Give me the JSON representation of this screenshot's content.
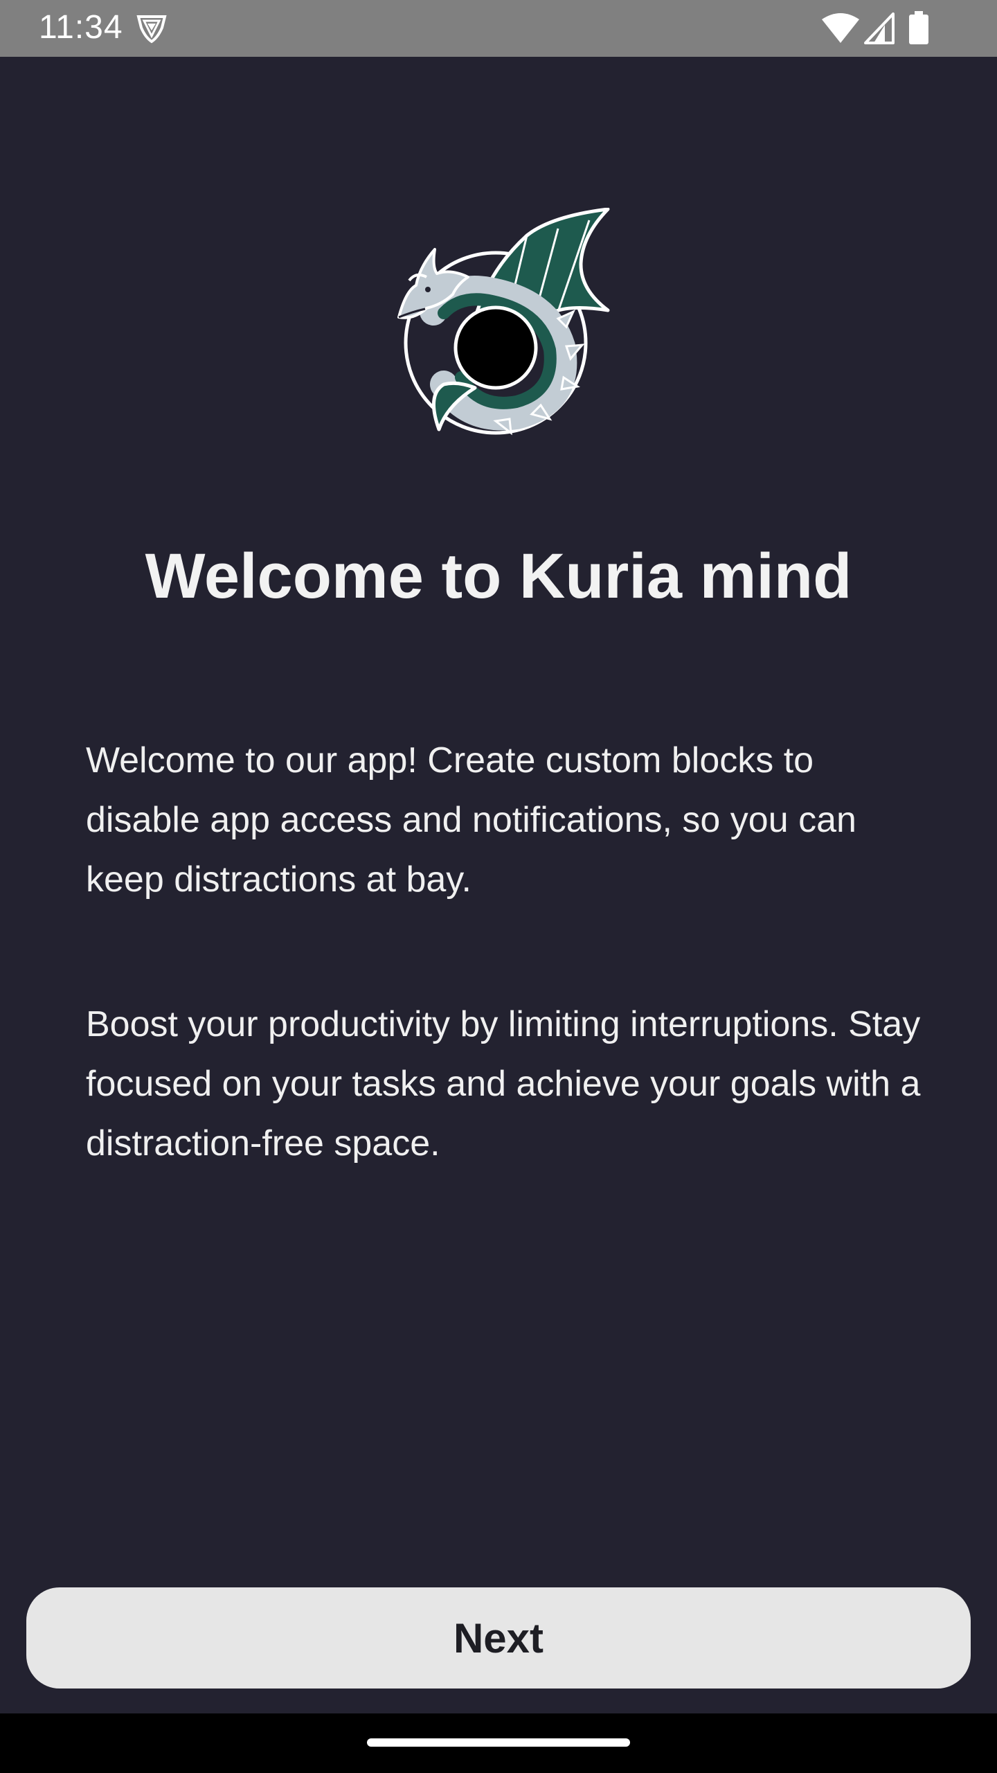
{
  "status_bar": {
    "time": "11:34",
    "icons": [
      "vpn-shield-icon",
      "wifi-icon",
      "cell-signal-icon",
      "battery-icon"
    ]
  },
  "logo": {
    "icon": "dragon-logo-icon",
    "colors": {
      "dragon_body": "#c2ccd4",
      "dragon_wing": "#1e5a4e",
      "orb": "#000000"
    }
  },
  "welcome": {
    "title": "Welcome to Kuria mind",
    "paragraph_1": "Welcome to our app! Create custom blocks to disable app access and notifications, so you can keep distractions at bay.",
    "paragraph_2": "Boost your productivity by limiting interruptions. Stay focused on your tasks and achieve your goals with a distraction-free space."
  },
  "actions": {
    "next_label": "Next"
  },
  "theme": {
    "background": "#232230",
    "button_bg": "#e6e6e6",
    "status_bar_bg": "#808080"
  }
}
